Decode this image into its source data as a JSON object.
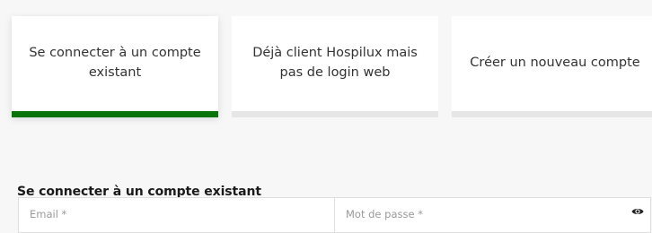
{
  "tabs": [
    {
      "label": "Se connecter à un compte existant",
      "active": true
    },
    {
      "label": "Déjà client Hospilux mais pas de login web",
      "active": false
    },
    {
      "label": "Créer un nouveau compte",
      "active": false
    }
  ],
  "colors": {
    "accent": "#087409",
    "inactive_bar": "#e6e6e6",
    "background": "#f7f7f7"
  },
  "section": {
    "title": "Se connecter à un compte existant"
  },
  "form": {
    "email": {
      "placeholder": "Email *",
      "value": ""
    },
    "password": {
      "placeholder": "Mot de passe *",
      "value": "",
      "icon": "eye-icon"
    }
  }
}
